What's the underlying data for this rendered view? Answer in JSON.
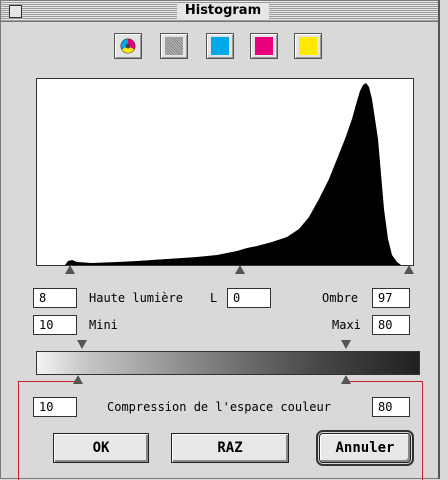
{
  "window": {
    "title": "Histogram"
  },
  "channels": [
    {
      "id": "all",
      "icon": "color-wheel-icon"
    },
    {
      "id": "gray",
      "icon": "gray-pattern-icon",
      "color": "#a8a8a8"
    },
    {
      "id": "cyan",
      "icon": "cyan-swatch-icon",
      "color": "#00a8e8"
    },
    {
      "id": "magenta",
      "icon": "magenta-swatch-icon",
      "color": "#e8007c"
    },
    {
      "id": "yellow",
      "icon": "yellow-swatch-icon",
      "color": "#ffea00"
    }
  ],
  "levels": {
    "highlight_value": "8",
    "highlight_label": "Haute lumière",
    "l_label": "L",
    "l_value": "0",
    "shadow_label": "Ombre",
    "shadow_value": "97",
    "mini_value": "10",
    "mini_label": "Mini",
    "maxi_label": "Maxi",
    "maxi_value": "80"
  },
  "compression": {
    "min_value": "10",
    "label": "Compression de l'espace couleur",
    "max_value": "80"
  },
  "buttons": {
    "ok": "OK",
    "raz": "RAZ",
    "cancel": "Annuler"
  },
  "colors": {
    "accent_frame": "#c8202a",
    "window_bg": "#d9d9d9"
  }
}
